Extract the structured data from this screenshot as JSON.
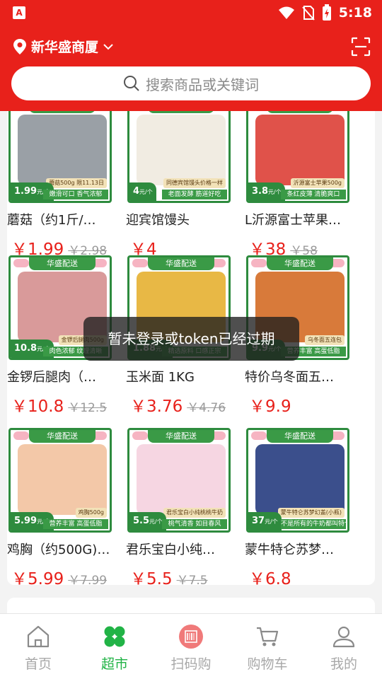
{
  "status_bar": {
    "time": "5:18",
    "app_letter": "A"
  },
  "header": {
    "location": "新华盛商厦",
    "search_placeholder": "搜索商品或关键词"
  },
  "products": [
    {
      "name": "蘑菇（约1斤/…",
      "price": "￥1.99",
      "old_price": "￥2.98",
      "tag_price": "1.99",
      "tag_unit": "元/个",
      "promo": "嫩滑可口 香气浓郁",
      "mini_label": "蘑菇500g 限11.13日",
      "banner": "华盛配送",
      "img_color": "#9aa0a6"
    },
    {
      "name": "迎宾馆馒头",
      "price": "￥4",
      "old_price": "",
      "tag_price": "4",
      "tag_unit": "元/个",
      "promo": "老面发酵 筋道好吃",
      "mini_label": "同德宾馆馒头价格一样",
      "banner": "华盛配送",
      "img_color": "#f1ece2"
    },
    {
      "name": "L沂源富士苹果…",
      "price": "￥38",
      "old_price": "￥58",
      "tag_price": "3.8",
      "tag_unit": "元/个",
      "promo": "条红皮薄 清脆爽口",
      "mini_label": "沂源富士苹果500g",
      "banner": "华盛配送",
      "img_color": "#e0524a"
    },
    {
      "name": "金锣后腿肉（…",
      "price": "￥10.8",
      "old_price": "￥12.5",
      "tag_price": "10.8",
      "tag_unit": "元/个",
      "promo": "肉色浓郁 纹理清晰",
      "mini_label": "金锣后腿肉500g",
      "banner": "华盛配送",
      "img_color": "#d99a9a"
    },
    {
      "name": "玉米面 1KG",
      "price": "￥3.76",
      "old_price": "￥4.76",
      "tag_price": "1.88",
      "tag_unit": "元/个",
      "promo": "精选原料 口感正宗",
      "mini_label": "",
      "banner": "华盛配送",
      "img_color": "#e8b845"
    },
    {
      "name": "特价乌冬面五…",
      "price": "￥9.9",
      "old_price": "",
      "tag_price": "9.9",
      "tag_unit": "元/个",
      "promo": "营养丰富 高蛋低脂",
      "mini_label": "乌冬面五连包",
      "banner": "华盛配送",
      "img_color": "#d87a3a"
    },
    {
      "name": "鸡胸（约500G)…",
      "price": "￥5.99",
      "old_price": "￥7.99",
      "tag_price": "5.99",
      "tag_unit": "元/个",
      "promo": "营养丰富 高蛋低脂",
      "mini_label": "鸡胸500g",
      "banner": "华盛配送",
      "img_color": "#f3c8a8"
    },
    {
      "name": "君乐宝白小纯…",
      "price": "￥5.5",
      "old_price": "￥7.5",
      "tag_price": "5.5",
      "tag_unit": "元/个",
      "promo": "桃气清香 如目春风",
      "mini_label": "君乐宝白小纯桃桃牛奶",
      "banner": "华盛配送",
      "img_color": "#f6d6e2"
    },
    {
      "name": "蒙牛特仑苏梦…",
      "price": "￥6.8",
      "old_price": "",
      "tag_price": "37",
      "tag_unit": "元/个",
      "promo": "不是所有的牛奶都叫特仑苏",
      "mini_label": "蒙牛特仑苏梦幻盖(小瓶)",
      "banner": "华盛配送",
      "img_color": "#3b4f8c"
    }
  ],
  "toast": "暂未登录或token已经过期",
  "tabs": [
    {
      "label": "首页",
      "icon": "home-icon",
      "active": false
    },
    {
      "label": "超市",
      "icon": "clover-icon",
      "active": true
    },
    {
      "label": "扫码购",
      "icon": "barcode-icon",
      "active": false
    },
    {
      "label": "购物车",
      "icon": "cart-icon",
      "active": false
    },
    {
      "label": "我的",
      "icon": "user-icon",
      "active": false
    }
  ],
  "colors": {
    "brand_red": "#e8211b",
    "tab_active_green": "#21b346",
    "frame_green": "#2e8b3e"
  }
}
